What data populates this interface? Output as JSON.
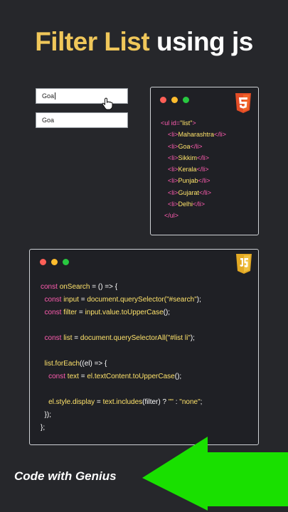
{
  "title": {
    "highlight": "Filter List",
    "rest": " using js"
  },
  "demo": {
    "search_value": "Goa",
    "result_item": "Goa"
  },
  "html_window": {
    "badge": "html5-icon",
    "lines": [
      [
        {
          "t": "<ul ",
          "c": "tag"
        },
        {
          "t": "id=",
          "c": "tag"
        },
        {
          "t": "\"list\"",
          "c": "str"
        },
        {
          "t": ">",
          "c": "tag"
        }
      ],
      [
        {
          "t": "    <li>",
          "c": "tag"
        },
        {
          "t": "Maharashtra",
          "c": "content"
        },
        {
          "t": "</li>",
          "c": "tag"
        }
      ],
      [
        {
          "t": "    <li>",
          "c": "tag"
        },
        {
          "t": "Goa",
          "c": "content"
        },
        {
          "t": "</li>",
          "c": "tag"
        }
      ],
      [
        {
          "t": "    <li>",
          "c": "tag"
        },
        {
          "t": "Sikkim",
          "c": "content"
        },
        {
          "t": "</li>",
          "c": "tag"
        }
      ],
      [
        {
          "t": "    <li>",
          "c": "tag"
        },
        {
          "t": "Kerala",
          "c": "content"
        },
        {
          "t": "</li>",
          "c": "tag"
        }
      ],
      [
        {
          "t": "    <li>",
          "c": "tag"
        },
        {
          "t": "Punjab",
          "c": "content"
        },
        {
          "t": "</li>",
          "c": "tag"
        }
      ],
      [
        {
          "t": "    <li>",
          "c": "tag"
        },
        {
          "t": "Gujarat",
          "c": "content"
        },
        {
          "t": "</li>",
          "c": "tag"
        }
      ],
      [
        {
          "t": "    <li>",
          "c": "tag"
        },
        {
          "t": "Delhi",
          "c": "content"
        },
        {
          "t": "</li>",
          "c": "tag"
        }
      ],
      [
        {
          "t": "  </ul>",
          "c": "tag"
        }
      ]
    ]
  },
  "js_window": {
    "badge": "js-icon",
    "lines": [
      [
        {
          "t": "const ",
          "c": "kw"
        },
        {
          "t": "onSearch",
          "c": "fn"
        },
        {
          "t": " = () => {",
          "c": "plain"
        }
      ],
      [
        {
          "t": "  const ",
          "c": "kw"
        },
        {
          "t": "input",
          "c": "fn"
        },
        {
          "t": " = ",
          "c": "plain"
        },
        {
          "t": "document.querySelector(",
          "c": "fn"
        },
        {
          "t": "\"#search\"",
          "c": "str"
        },
        {
          "t": ");",
          "c": "plain"
        }
      ],
      [
        {
          "t": "  const ",
          "c": "kw"
        },
        {
          "t": "filter",
          "c": "fn"
        },
        {
          "t": " = ",
          "c": "plain"
        },
        {
          "t": "input.value.toUpperCase",
          "c": "fn"
        },
        {
          "t": "();",
          "c": "plain"
        }
      ],
      [
        {
          "t": "",
          "c": "plain"
        }
      ],
      [
        {
          "t": "  const ",
          "c": "kw"
        },
        {
          "t": "list",
          "c": "fn"
        },
        {
          "t": " = ",
          "c": "plain"
        },
        {
          "t": "document.querySelectorAll(",
          "c": "fn"
        },
        {
          "t": "\"#list li\"",
          "c": "str"
        },
        {
          "t": ");",
          "c": "plain"
        }
      ],
      [
        {
          "t": "",
          "c": "plain"
        }
      ],
      [
        {
          "t": "  list.forEach",
          "c": "fn"
        },
        {
          "t": "((el) => {",
          "c": "plain"
        }
      ],
      [
        {
          "t": "    const ",
          "c": "kw"
        },
        {
          "t": "text",
          "c": "fn"
        },
        {
          "t": " = ",
          "c": "plain"
        },
        {
          "t": "el.textContent.toUpperCase",
          "c": "fn"
        },
        {
          "t": "();",
          "c": "plain"
        }
      ],
      [
        {
          "t": "",
          "c": "plain"
        }
      ],
      [
        {
          "t": "    el.style.display",
          "c": "fn"
        },
        {
          "t": " = ",
          "c": "plain"
        },
        {
          "t": "text.includes",
          "c": "fn"
        },
        {
          "t": "(filter) ? ",
          "c": "plain"
        },
        {
          "t": "\"\"",
          "c": "str"
        },
        {
          "t": " : ",
          "c": "plain"
        },
        {
          "t": "\"none\"",
          "c": "str"
        },
        {
          "t": ";",
          "c": "plain"
        }
      ],
      [
        {
          "t": "  });",
          "c": "plain"
        }
      ],
      [
        {
          "t": "};",
          "c": "plain"
        }
      ]
    ]
  },
  "footer": {
    "label": "Code with Genius"
  },
  "colors": {
    "accent": "#f0c75a",
    "arrow": "#19e000",
    "dot_red": "#ff5f57",
    "dot_yellow": "#febc2e",
    "dot_green": "#28c840"
  }
}
